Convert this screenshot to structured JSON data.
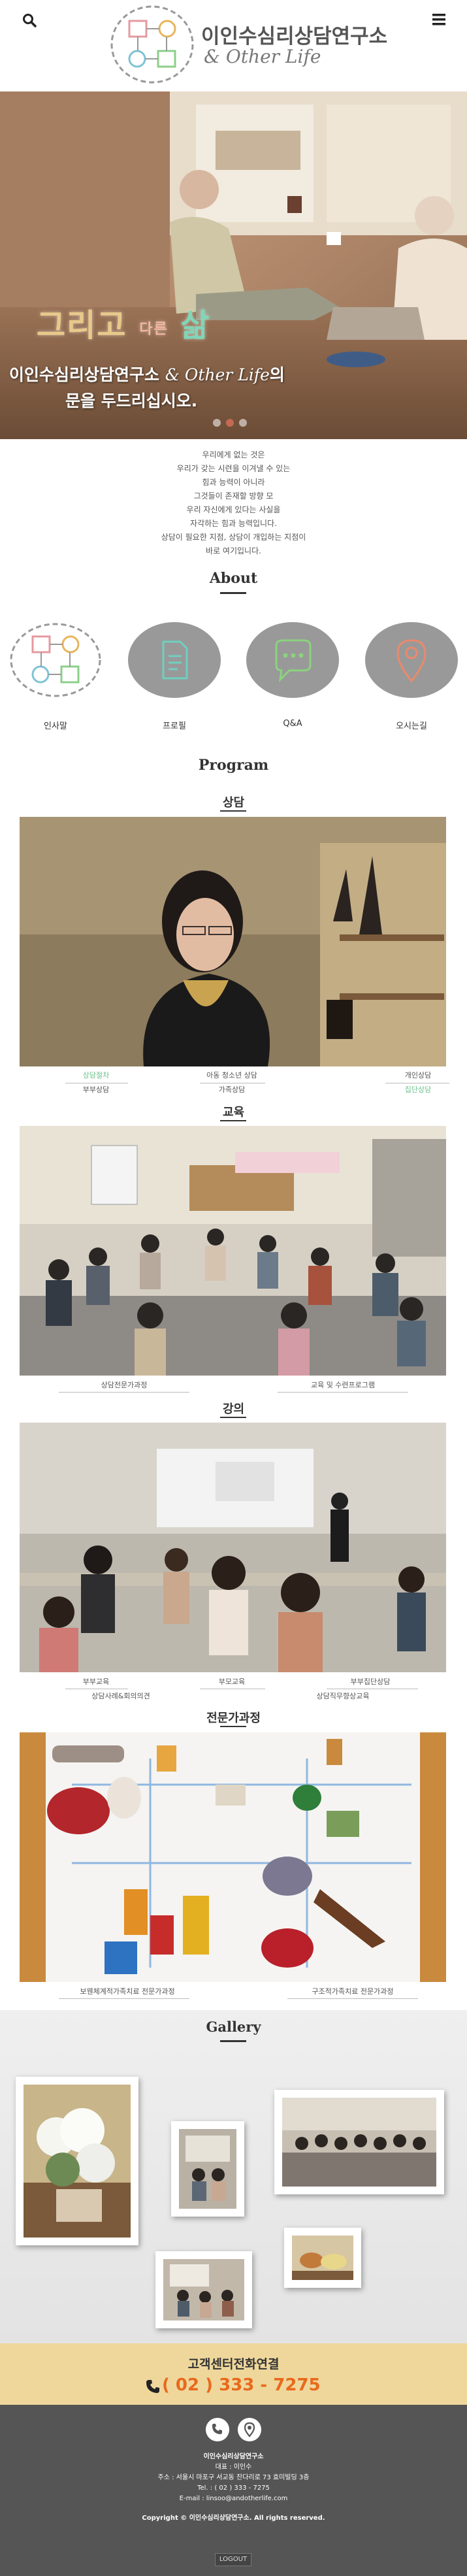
{
  "header": {
    "title": "이인수심리상담연구소",
    "subtitle": "& Other Life",
    "search_icon": "search-icon",
    "menu_icon": "hamburger-menu-icon"
  },
  "hero": {
    "headline_part1": "그리고",
    "headline_small": "다른",
    "headline_part2": "삶",
    "line1_a": "이인수심리상담연구소",
    "line1_b": "& Other Life",
    "line1_c": "의",
    "line2": "문을 두드리십시오.",
    "slides": 3,
    "active_slide": 1
  },
  "intro": [
    "우리에게 없는 것은",
    "우리가 갖는 시련을 이겨낼 수 있는",
    "힘과 능력이 아니라",
    "그것들이 존재할 방향 모",
    "우리 자신에게 있다는 사실을",
    "자각하는 힘과 능력입니다.",
    "상담이 필요한 지점, 상담이 개입하는 지점이",
    "바로 여기입니다."
  ],
  "about": {
    "title": "About",
    "items": [
      {
        "label": "인사말",
        "icon": "logo-shapes-icon"
      },
      {
        "label": "프로필",
        "icon": "document-icon"
      },
      {
        "label": "Q&A",
        "icon": "chat-bubble-icon"
      },
      {
        "label": "오시는길",
        "icon": "map-pin-icon"
      }
    ]
  },
  "program": {
    "title": "Program",
    "counseling": {
      "title": "상담",
      "tags": [
        {
          "label": "상담절차",
          "green": true
        },
        {
          "label": "아동 청소년 상담",
          "green": false
        },
        {
          "label": "개인상담",
          "green": false
        },
        {
          "label": "부부상담",
          "green": false
        },
        {
          "label": "가족상담",
          "green": false
        },
        {
          "label": "집단상담",
          "green": true
        }
      ]
    },
    "education": {
      "title": "교육",
      "tags": [
        "상담전문가과정",
        "교육 및 수련프로그램"
      ]
    },
    "lecture": {
      "title": "강의",
      "tags": [
        "부부교육",
        "부모교육",
        "부부집단상담",
        "상담사례&회의의견",
        "상담직무향상교육"
      ]
    },
    "expert": {
      "title": "전문가과정",
      "tags": [
        "보웬체계적가족치료 전문가과정",
        "구조적가족치료 전문가과정"
      ]
    }
  },
  "gallery": {
    "title": "Gallery"
  },
  "call": {
    "title": "고객센터전화연결",
    "number": "( 02 ) 333 - 7275"
  },
  "footer": {
    "lines": [
      "이인수심리상담연구소",
      "대표 : 이인수",
      "주소 : 서울시 마포구 서교동 잔다리로 73 효미빌딩 3층",
      "Tel. : ( 02 ) 333 - 7275",
      "E-mail : linsoo@andotherlife.com"
    ],
    "copyright_a": "Copyright ©",
    "copyright_b": "이인수심리상담연구소. All rights reserved.",
    "logout": "LOGOUT"
  },
  "colors": {
    "accent_green": "#6cc08c",
    "call_orange": "#e86a1c",
    "call_bar": "#efd79c",
    "footer_bg": "#555555",
    "about_circle": "#999999"
  }
}
